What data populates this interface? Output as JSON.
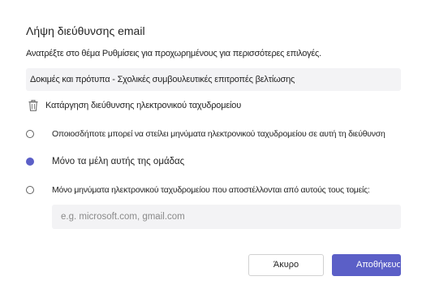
{
  "dialog": {
    "title": "Λήψη διεύθυνσης email",
    "subtitle": "Ανατρέξτε στο θέμα Ρυθμίσεις για προχωρημένους για περισσότερες επιλογές.",
    "email_address": "Δοκιμές και πρότυπα - Σχολικές συμβουλευτικές επιτροπές βελτίωσης",
    "remove_label": "Κατάργηση διεύθυνσης ηλεκτρονικού ταχυδρομείου",
    "options": [
      {
        "label": "Οποιοσδήποτε μπορεί να στείλει μηνύματα ηλεκτρονικού ταχυδρομείου σε αυτή τη διεύθυνση",
        "selected": false
      },
      {
        "label": "Μόνο τα μέλη αυτής της ομάδας",
        "selected": true
      },
      {
        "label": "Μόνο μηνύματα ηλεκτρονικού ταχυδρομείου που αποστέλλονται από αυτούς τους τομείς:",
        "selected": false
      }
    ],
    "domains_input": {
      "value": "",
      "placeholder": "e.g. microsoft.com, gmail.com"
    },
    "cancel_label": "Άκυρο",
    "save_label": "Αποθήκευση"
  },
  "icons": {
    "trash": "trash-icon",
    "radio_checked": "radio-checked-icon",
    "radio_unchecked": "radio-unchecked-icon"
  },
  "colors": {
    "accent": "#5b5fc7",
    "field_background": "#f3f3f5",
    "text": "#242424",
    "placeholder": "#8a8a8a"
  }
}
